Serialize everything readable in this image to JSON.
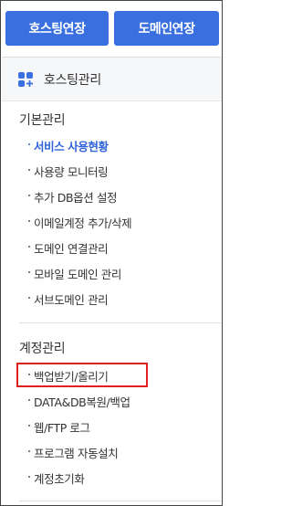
{
  "top_buttons": {
    "hosting_extend": "호스팅연장",
    "domain_extend": "도메인연장"
  },
  "section": {
    "icon": "grid-plus-icon",
    "title": "호스팅관리",
    "accent_color": "#3a6fe0"
  },
  "groups": [
    {
      "title": "기본관리",
      "items": [
        {
          "label": "서비스 사용현황",
          "active": true
        },
        {
          "label": "사용량 모니터링"
        },
        {
          "label": "추가 DB옵션 설정"
        },
        {
          "label": "이메일계정 추가/삭제"
        },
        {
          "label": "도메인 연결관리"
        },
        {
          "label": "모바일 도메인 관리"
        },
        {
          "label": "서브도메인 관리"
        }
      ]
    },
    {
      "title": "계정관리",
      "items": [
        {
          "label": "백업받기/올리기",
          "highlighted": true
        },
        {
          "label": "DATA&DB복원/백업"
        },
        {
          "label": "웹/FTP 로그"
        },
        {
          "label": "프로그램 자동설치"
        },
        {
          "label": "계정초기화"
        }
      ]
    }
  ]
}
